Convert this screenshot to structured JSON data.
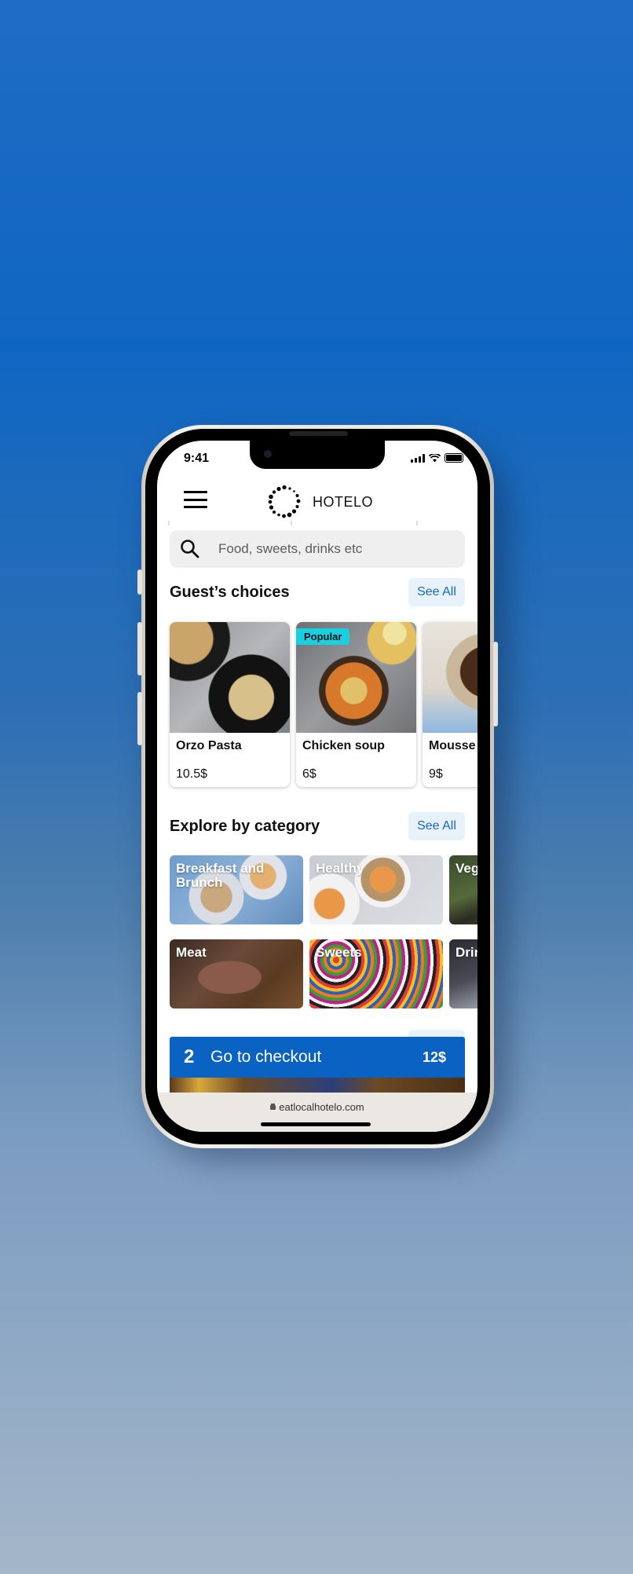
{
  "status_bar": {
    "time": "9:41"
  },
  "header": {
    "brand": "HOTELO"
  },
  "search": {
    "placeholder": "Food, sweets, drinks etc"
  },
  "guests_choices": {
    "title": "Guest’s choices",
    "see_all": "See All",
    "items": [
      {
        "name": "Orzo Pasta",
        "price": "10.5$",
        "badge": ""
      },
      {
        "name": "Chicken soup",
        "price": "6$",
        "badge": "Popular"
      },
      {
        "name": "Mousse",
        "price": "9$",
        "badge": ""
      }
    ]
  },
  "categories": {
    "title": "Explore by category",
    "see_all": "See All",
    "row1": [
      "Breakfast and Brunch",
      "Healthy",
      "Vegan"
    ],
    "row2": [
      "Meat",
      "Sweets",
      "Drinks"
    ]
  },
  "checkout": {
    "count": "2",
    "label": "Go to checkout",
    "total": "12$"
  },
  "browser": {
    "url": "eatlocalhotelo.com"
  },
  "colors": {
    "accent": "#0a63c2",
    "badge": "#1ad0e0",
    "see_all_bg": "#e7f2fb"
  }
}
